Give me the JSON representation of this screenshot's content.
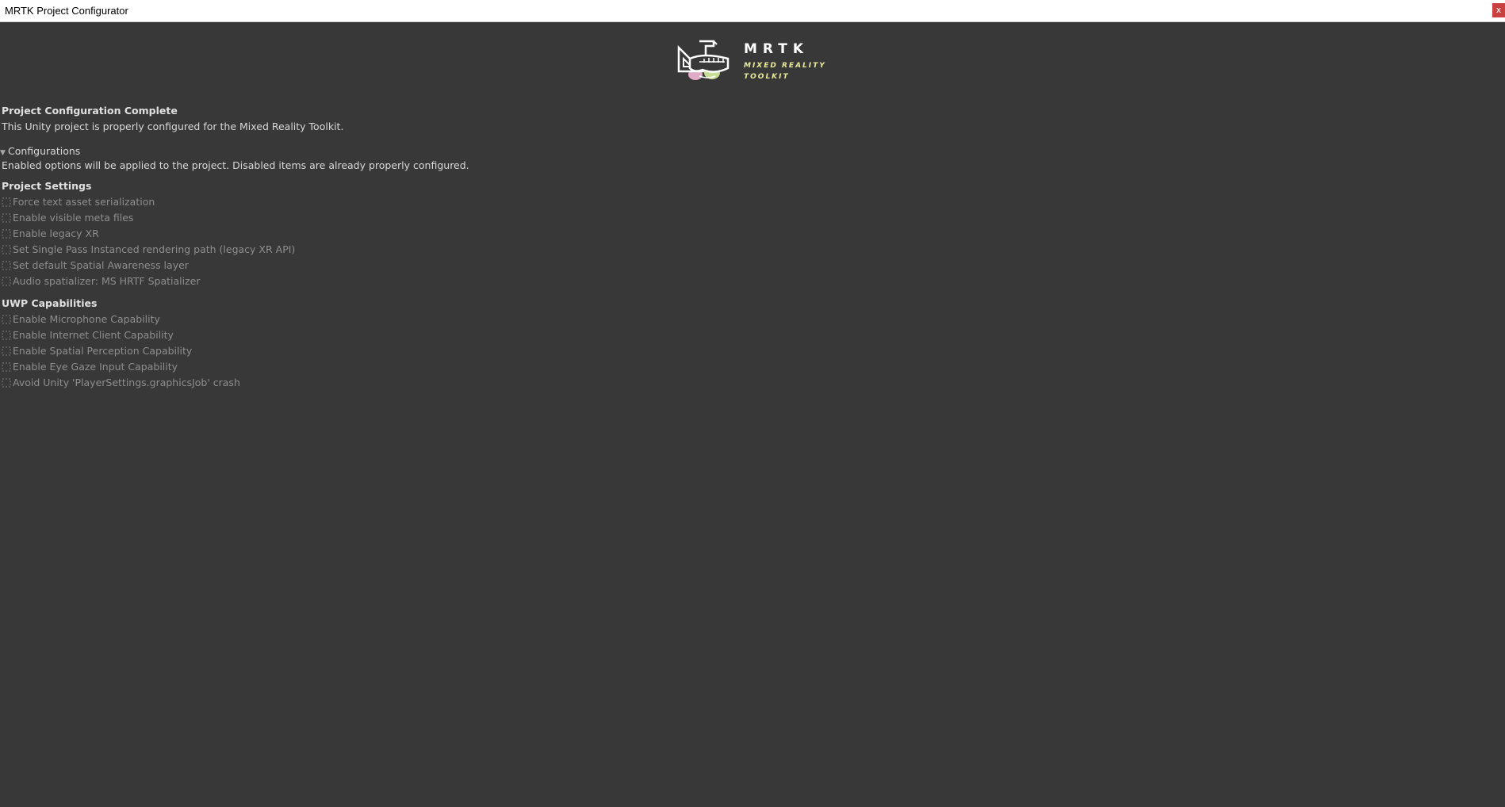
{
  "window": {
    "title": "MRTK Project Configurator",
    "close_label": "x"
  },
  "logo": {
    "mrtk": "MRTK",
    "subtitle_line1": "MIXED REALITY",
    "subtitle_line2": "TOOLKIT"
  },
  "status": {
    "heading": "Project Configuration Complete",
    "message": "This Unity project is properly configured for the Mixed Reality Toolkit."
  },
  "configurations": {
    "label": "Configurations",
    "expanded": true,
    "description": "Enabled options will be applied to the project. Disabled items are already properly configured."
  },
  "project_settings": {
    "heading": "Project Settings",
    "items": [
      "Force text asset serialization",
      "Enable visible meta files",
      "Enable legacy XR",
      "Set Single Pass Instanced rendering path (legacy XR API)",
      "Set default Spatial Awareness layer",
      "Audio spatializer: MS HRTF Spatializer"
    ]
  },
  "uwp_capabilities": {
    "heading": "UWP Capabilities",
    "items": [
      "Enable Microphone Capability",
      "Enable Internet Client Capability",
      "Enable Spatial Perception Capability",
      "Enable Eye Gaze Input Capability",
      "Avoid Unity 'PlayerSettings.graphicsJob' crash"
    ]
  },
  "colors": {
    "background": "#383838",
    "titlebar": "#ffffff",
    "close_button": "#c94040",
    "disabled_text": "#8e8e8e",
    "logo_accent": "#e8ea9a"
  }
}
